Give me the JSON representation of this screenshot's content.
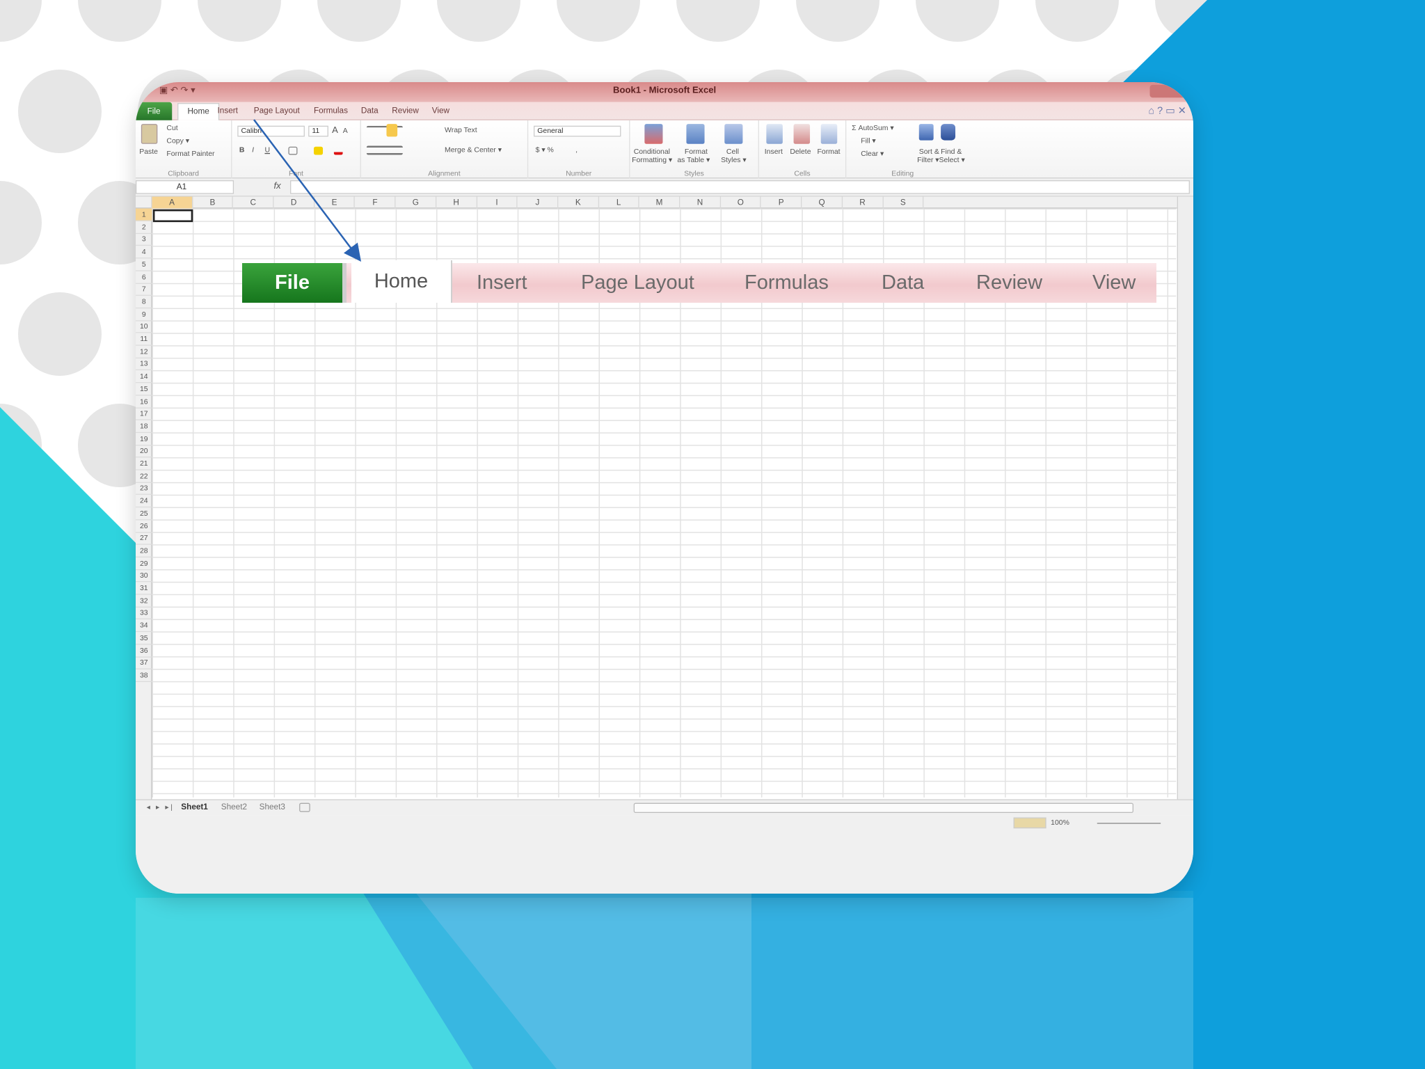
{
  "background": {
    "white": "#ffffff",
    "dot_color": "#e6e6e6",
    "cyan": "#2ed3de",
    "blue": "#0e9fdc"
  },
  "window": {
    "title": "Book1 - Microsoft Excel",
    "qat_symbols": "▣ ↶ ↷ ▾",
    "control_symbols": "⌂ ? ▭ ✕",
    "tabs": [
      "File",
      "Home",
      "Insert",
      "Page Layout",
      "Formulas",
      "Data",
      "Review",
      "View"
    ],
    "active_tab": "Home",
    "file_tab_color": "#2e8b35"
  },
  "ribbon": {
    "clipboard": {
      "paste": "Paste",
      "cut": "Cut",
      "copy": "Copy ▾",
      "format_painter": "Format Painter",
      "label": "Clipboard"
    },
    "font": {
      "name": "Calibri",
      "size": "11",
      "grow": "A",
      "shrink": "A",
      "bold": "B",
      "italic": "I",
      "underline": "U",
      "label": "Font"
    },
    "alignment": {
      "wrap": "Wrap Text",
      "merge": "Merge & Center ▾",
      "label": "Alignment"
    },
    "number": {
      "format": "General",
      "currency": "$ ▾ %",
      "comma": ",",
      "label": "Number"
    },
    "styles": {
      "conditional": "Conditional",
      "conditional2": "Formatting ▾",
      "format_table": "Format",
      "format_table2": "as Table ▾",
      "cell_styles": "Cell",
      "cell_styles2": "Styles ▾",
      "label": "Styles"
    },
    "cells": {
      "insert": "Insert",
      "delete": "Delete",
      "format": "Format",
      "label": "Cells"
    },
    "editing": {
      "autosum": "Σ AutoSum ▾",
      "fill": "Fill ▾",
      "clear": "Clear ▾",
      "sort": "Sort &",
      "sort2": "Filter ▾",
      "find": "Find &",
      "find2": "Select ▾",
      "label": "Editing"
    }
  },
  "formula_bar": {
    "name_box": "A1",
    "fx": "fx",
    "value": ""
  },
  "columns": [
    "A",
    "B",
    "C",
    "D",
    "E",
    "F",
    "G",
    "H",
    "I",
    "J",
    "K",
    "L",
    "M",
    "N",
    "O",
    "P",
    "Q",
    "R",
    "S"
  ],
  "rows": [
    "1",
    "2",
    "3",
    "4",
    "5",
    "6",
    "7",
    "8",
    "9",
    "10",
    "11",
    "12",
    "13",
    "14",
    "15",
    "16",
    "17",
    "18",
    "19",
    "20",
    "21",
    "22",
    "23",
    "24",
    "25",
    "26",
    "27",
    "28",
    "29",
    "30",
    "31",
    "32",
    "33",
    "34",
    "35",
    "36",
    "37",
    "38"
  ],
  "sheets": [
    "Sheet1",
    "Sheet2",
    "Sheet3"
  ],
  "active_sheet": "Sheet1",
  "sheet_nav": "◂ ▸ ▸|",
  "status": {
    "zoom": "100%"
  },
  "callout": {
    "tabs": [
      "File",
      "Home",
      "Insert",
      "Page Layout",
      "Formulas",
      "Data",
      "Review",
      "View"
    ]
  }
}
